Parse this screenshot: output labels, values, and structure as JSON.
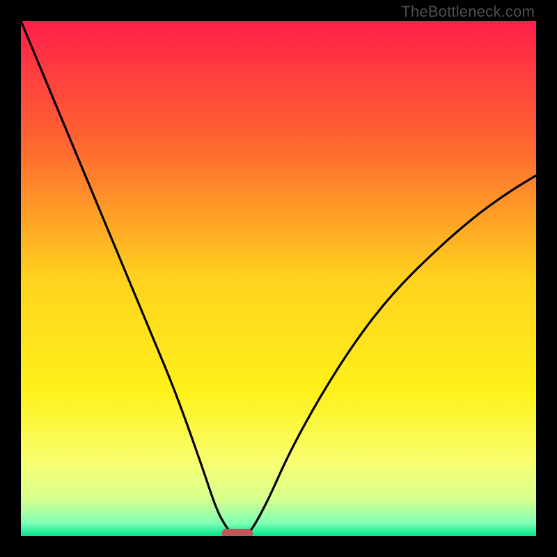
{
  "watermark": "TheBottleneck.com",
  "chart_data": {
    "type": "line",
    "title": "",
    "xlabel": "",
    "ylabel": "",
    "xlim": [
      0,
      100
    ],
    "ylim": [
      0,
      100
    ],
    "grid": false,
    "legend": false,
    "background_gradient_stops": [
      {
        "offset": 0.0,
        "color": "#ff1f4b"
      },
      {
        "offset": 0.25,
        "color": "#ff6a2f"
      },
      {
        "offset": 0.5,
        "color": "#ffd21e"
      },
      {
        "offset": 0.72,
        "color": "#fff11a"
      },
      {
        "offset": 0.86,
        "color": "#f8ff73"
      },
      {
        "offset": 0.93,
        "color": "#d5ff8e"
      },
      {
        "offset": 0.975,
        "color": "#7dffb5"
      },
      {
        "offset": 1.0,
        "color": "#00e58a"
      }
    ],
    "series": [
      {
        "name": "bottleneck-curve",
        "x": [
          0,
          5,
          10,
          15,
          20,
          25,
          30,
          35,
          38,
          40,
          41,
          42,
          43,
          44,
          45,
          48,
          52,
          58,
          65,
          72,
          80,
          88,
          95,
          100
        ],
        "y": [
          100,
          88,
          76,
          64,
          52,
          40,
          28,
          14,
          5,
          1.5,
          0.6,
          0.2,
          0.2,
          0.6,
          1.5,
          7,
          16,
          27,
          38,
          47,
          55,
          62,
          67,
          70
        ]
      }
    ],
    "marker": {
      "name": "optimal-range",
      "x_center": 42,
      "x_halfwidth": 3,
      "y": 0.5,
      "color": "#c15858"
    }
  }
}
